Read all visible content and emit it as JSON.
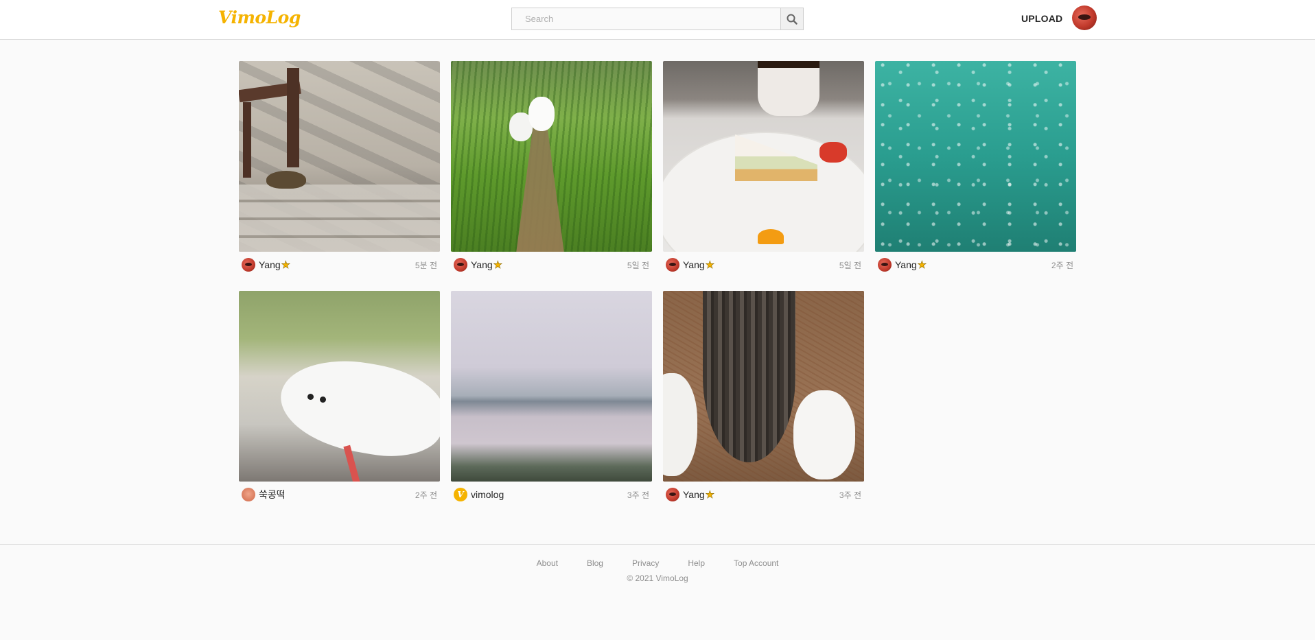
{
  "header": {
    "logo": "VimoLog",
    "search": {
      "placeholder": "Search",
      "value": ""
    },
    "upload_label": "UPLOAD"
  },
  "posts": [
    {
      "author": "Yang",
      "verified": true,
      "time": "5분 전",
      "avatar": "red"
    },
    {
      "author": "Yang",
      "verified": true,
      "time": "5일 전",
      "avatar": "red"
    },
    {
      "author": "Yang",
      "verified": true,
      "time": "5일 전",
      "avatar": "red"
    },
    {
      "author": "Yang",
      "verified": true,
      "time": "2주 전",
      "avatar": "red"
    },
    {
      "author": "쑥콩떡",
      "verified": false,
      "time": "2주 전",
      "avatar": "peach"
    },
    {
      "author": "vimolog",
      "verified": false,
      "time": "3주 전",
      "avatar": "yellow-v"
    },
    {
      "author": "Yang",
      "verified": true,
      "time": "3주 전",
      "avatar": "red"
    }
  ],
  "footer": {
    "links": [
      "About",
      "Blog",
      "Privacy",
      "Help",
      "Top Account"
    ],
    "copyright": "© 2021 VimoLog"
  },
  "colors": {
    "brand": "#f5b301",
    "background": "#fafafa",
    "border": "#dbdbdb",
    "muted_text": "#8e8e8e"
  },
  "icons": {
    "search": "search-icon",
    "verified": "star-icon"
  }
}
